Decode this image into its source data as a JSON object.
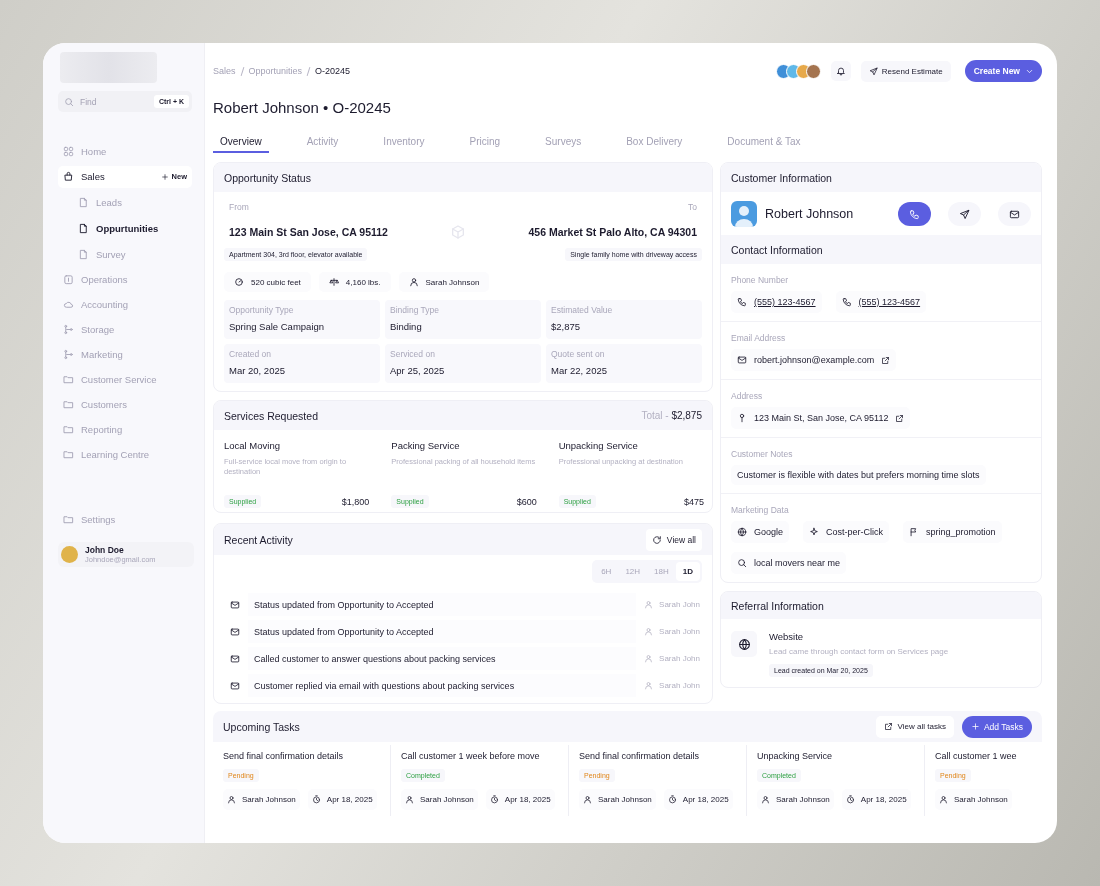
{
  "sidebar": {
    "search": {
      "placeholder": "Find",
      "shortcut": "Ctrl + K"
    },
    "items": [
      {
        "label": "Home",
        "selected": false,
        "expanded": false
      },
      {
        "label": "Sales",
        "selected": false,
        "expanded": true,
        "action": "New",
        "children": [
          {
            "label": "Leads",
            "selected": false
          },
          {
            "label": "Oppurtunities",
            "selected": true
          },
          {
            "label": "Survey",
            "selected": false
          }
        ]
      },
      {
        "label": "Operations",
        "selected": false,
        "expanded": false
      },
      {
        "label": "Accounting",
        "selected": false,
        "expanded": false
      },
      {
        "label": "Storage",
        "selected": false,
        "expanded": false
      },
      {
        "label": "Marketing",
        "selected": false,
        "expanded": false
      },
      {
        "label": "Customer Service",
        "selected": false,
        "expanded": false
      },
      {
        "label": "Customers",
        "selected": false,
        "expanded": false
      },
      {
        "label": "Reporting",
        "selected": false,
        "expanded": false
      },
      {
        "label": "Learning Centre",
        "selected": false,
        "expanded": false
      }
    ],
    "settings": "Settings",
    "user": {
      "name": "John Doe",
      "email": "Johndoe@gmail.com"
    }
  },
  "header": {
    "breadcrumbs": [
      "Sales",
      "Opportunities",
      "O-20245"
    ],
    "resend_button": "Resend Estimate",
    "create_button": "Create New",
    "title": "Robert Johnson • O-20245",
    "tabs": [
      {
        "label": "Overview",
        "selected": true
      },
      {
        "label": "Activity",
        "selected": false
      },
      {
        "label": "Inventory",
        "selected": false
      },
      {
        "label": "Pricing",
        "selected": false
      },
      {
        "label": "Surveys",
        "selected": false
      },
      {
        "label": "Box Delivery",
        "selected": false
      },
      {
        "label": "Document & Tax",
        "selected": false
      }
    ]
  },
  "opportunity_status": {
    "title": "Opportunity Status",
    "from_label": "From",
    "to_label": "To",
    "from_address": "123 Main St San Jose, CA 95112",
    "to_address": "456 Market St Palo Alto, CA 94301",
    "from_note": "Apartment 304, 3rd floor, elevator available",
    "to_note": "Single family home with driveway access",
    "stats": [
      "520 cubic feet",
      "4,160 lbs.",
      "Sarah Johnson"
    ],
    "fields": [
      {
        "label": "Opportunity Type",
        "value": "Spring Sale Campaign"
      },
      {
        "label": "Binding Type",
        "value": "Binding"
      },
      {
        "label": "Estimated Value",
        "value": "$2,875"
      },
      {
        "label": "Created on",
        "value": "Mar 20, 2025"
      },
      {
        "label": "Serviced on",
        "value": "Apr 25, 2025"
      },
      {
        "label": "Quote sent on",
        "value": "Mar 22, 2025"
      }
    ]
  },
  "services": {
    "title": "Services Requested",
    "total_label": "Total -",
    "total": "$2,875",
    "items": [
      {
        "name": "Local Moving",
        "description": "Full-service local move from origin to destination",
        "status": "Supplied",
        "price": "$1,800"
      },
      {
        "name": "Packing Service",
        "description": "Professional packing of all household items",
        "status": "Supplied",
        "price": "$600"
      },
      {
        "name": "Unpacking Service",
        "description": "Professional unpacking at destination",
        "status": "Supplied",
        "price": "$475"
      }
    ]
  },
  "recent_activity": {
    "title": "Recent Activity",
    "view_all": "View all",
    "ranges": [
      {
        "label": "6H",
        "selected": false
      },
      {
        "label": "12H",
        "selected": false
      },
      {
        "label": "18H",
        "selected": false
      },
      {
        "label": "1D",
        "selected": true
      }
    ],
    "entries": [
      {
        "text": "Status updated from Opportunity to Accepted",
        "user": "Sarah John"
      },
      {
        "text": "Status updated from Opportunity to Accepted",
        "user": "Sarah John"
      },
      {
        "text": "Called customer to answer questions about packing services",
        "user": "Sarah John"
      },
      {
        "text": "Customer replied via email with questions about packing services",
        "user": "Sarah John"
      }
    ]
  },
  "customer": {
    "title": "Customer Information",
    "name": "Robert Johnson",
    "actions": [
      {
        "primary": true
      },
      {
        "primary": false
      },
      {
        "primary": false
      }
    ],
    "contact_title": "Contact Information",
    "phone_label": "Phone Number",
    "phones": [
      "(555) 123-4567",
      "(555) 123-4567"
    ],
    "email_label": "Email Address",
    "email": "robert.johnson@example.com",
    "address_label": "Address",
    "address": "123 Main St, San Jose, CA 95112",
    "notes_label": "Customer Notes",
    "notes": "Customer is flexible with dates but prefers morning time slots",
    "marketing_label": "Marketing Data",
    "marketing": [
      "Google",
      "Cost-per-Click",
      "spring_promotion",
      "local movers near me"
    ]
  },
  "referral": {
    "title": "Referral Information",
    "source": "Website",
    "description": "Lead came through contact form on Services page",
    "created": "Lead created on Mar 20, 2025"
  },
  "upcoming_tasks": {
    "title": "Upcoming Tasks",
    "view_all": "View all tasks",
    "add_button": "Add Tasks",
    "items": [
      {
        "title": "Send final confirmation details",
        "status": "Pending",
        "completed": false,
        "assignee": "Sarah Johnson",
        "date": "Apr 18, 2025"
      },
      {
        "title": "Call customer 1 week before move",
        "status": "Completed",
        "completed": true,
        "assignee": "Sarah Johnson",
        "date": "Apr 18, 2025"
      },
      {
        "title": "Send final confirmation details",
        "status": "Pending",
        "completed": false,
        "assignee": "Sarah Johnson",
        "date": "Apr 18, 2025"
      },
      {
        "title": "Unpacking Service",
        "status": "Completed",
        "completed": true,
        "assignee": "Sarah Johnson",
        "date": "Apr 18, 2025"
      },
      {
        "title": "Call customer 1 wee",
        "status": "Pending",
        "completed": false,
        "assignee": "Sarah Johnson"
      }
    ]
  }
}
